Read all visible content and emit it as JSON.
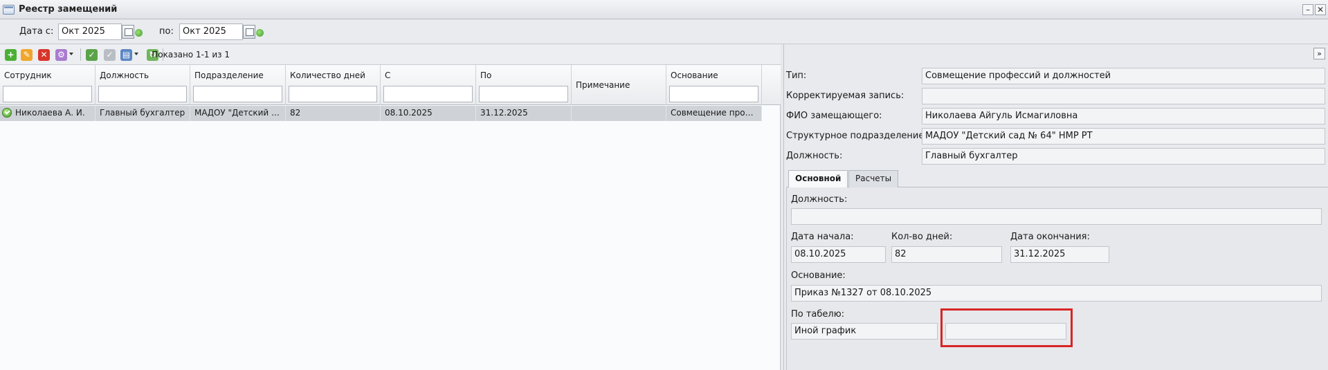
{
  "window": {
    "title": "Реестр замещений"
  },
  "filter": {
    "date_from_label": "Дата с:",
    "date_from_value": "Окт 2025",
    "date_to_label": "по:",
    "date_to_value": "Окт 2025"
  },
  "toolbar": {
    "shown_text": "Показано 1-1 из 1",
    "icons": [
      "add-icon",
      "edit-icon",
      "delete-icon",
      "settings-icon",
      "approve-icon",
      "unapprove-icon",
      "print-icon",
      "refresh-icon"
    ]
  },
  "grid": {
    "columns": [
      "Сотрудник",
      "Должность",
      "Подразделение",
      "Количество дней",
      "С",
      "По",
      "Примечание",
      "Основание"
    ],
    "rows": [
      {
        "employee": "Николаева А. И.",
        "position": "Главный бухгалтер",
        "department": "МАДОУ \"Детский сад...",
        "days": "82",
        "from": "08.10.2025",
        "to": "31.12.2025",
        "note": "",
        "basis": "Совмещение профе..."
      }
    ]
  },
  "details": {
    "type_label": "Тип:",
    "type_value": "Совмещение профессий и должностей",
    "corrected_label": "Корректируемая запись:",
    "corrected_value": "",
    "fio_label": "ФИО замещающего:",
    "fio_value": "Николаева Айгуль Исмагиловна",
    "dept_label": "Структурное подразделение:",
    "dept_value": "МАДОУ \"Детский сад № 64\" НМР РТ",
    "position_label": "Должность:",
    "position_value": "Главный бухгалтер"
  },
  "tabs": [
    {
      "label": "Основной",
      "active": true
    },
    {
      "label": "Расчеты",
      "active": false
    }
  ],
  "main_tab": {
    "position_label": "Должность:",
    "position_value": "",
    "start_label": "Дата начала:",
    "start_value": "08.10.2025",
    "days_label": "Кол-во дней:",
    "days_value": "82",
    "end_label": "Дата окончания:",
    "end_value": "31.12.2025",
    "basis_label": "Основание:",
    "basis_value": "Приказ №1327 от 08.10.2025",
    "timesheet_label": "По табелю:",
    "timesheet_value": "Иной график",
    "timesheet_extra_value": ""
  },
  "colors": {
    "highlight": "#d92424",
    "selected_row": "#cfd2d7"
  }
}
